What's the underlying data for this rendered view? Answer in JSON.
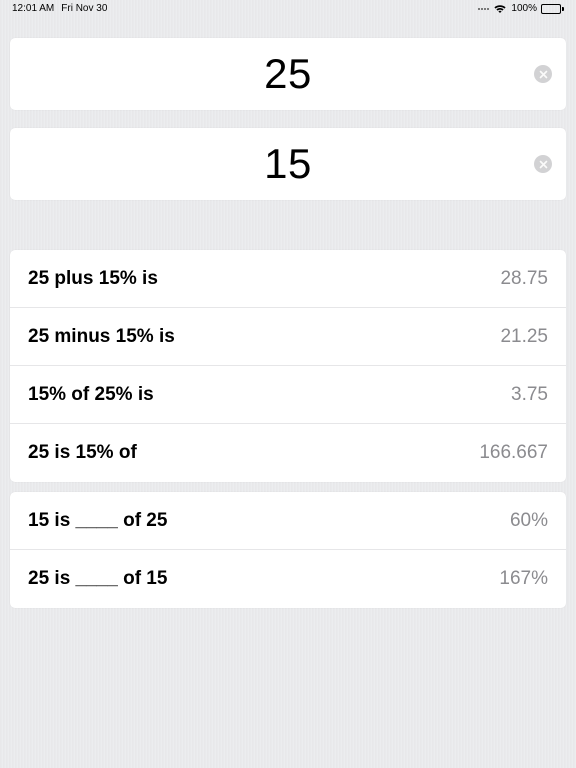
{
  "status": {
    "time": "12:01 AM",
    "date": "Fri Nov 30",
    "battery_pct": "100%"
  },
  "inputs": {
    "a": "25",
    "b": "15"
  },
  "results1": [
    {
      "label": "25 plus 15% is",
      "value": "28.75"
    },
    {
      "label": "25 minus 15% is",
      "value": "21.25"
    },
    {
      "label": "15% of 25% is",
      "value": "3.75"
    },
    {
      "label": "25 is 15% of",
      "value": "166.667"
    }
  ],
  "results2": [
    {
      "label": "15 is ____ of 25",
      "value": "60%"
    },
    {
      "label": "25 is ____ of 15",
      "value": "167%"
    }
  ]
}
